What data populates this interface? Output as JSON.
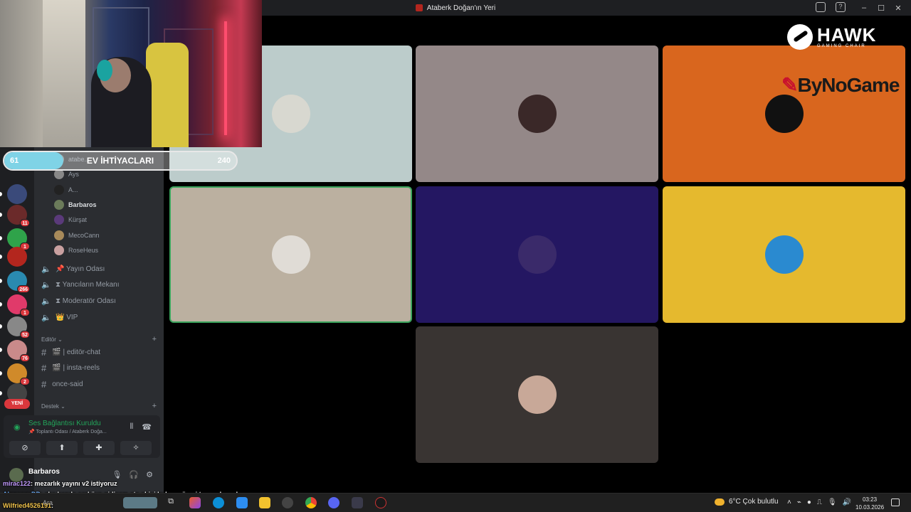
{
  "window": {
    "title": "Ataberk Doğan'ın Yeri",
    "controls": [
      "–",
      "☐",
      "✕"
    ]
  },
  "goal": {
    "current": "61",
    "label": "EV İHTİYACLARI",
    "target": "240",
    "progress_fraction": 0.254
  },
  "servers": [
    {
      "name": "server-1",
      "badge": "",
      "color": "#3a4a7a"
    },
    {
      "name": "server-2",
      "badge": "11",
      "color": "#6b2a2a"
    },
    {
      "name": "server-3",
      "badge": "1",
      "color": "#2fa34a"
    },
    {
      "name": "server-4",
      "badge": "",
      "color": "#b3261e"
    },
    {
      "name": "server-5",
      "badge": "266",
      "color": "#2a8ab0"
    },
    {
      "name": "server-6",
      "badge": "1",
      "color": "#e03a6a"
    },
    {
      "name": "server-7",
      "badge": "52",
      "color": "#888888"
    },
    {
      "name": "server-8",
      "badge": "76",
      "color": "#c98a8a"
    },
    {
      "name": "server-9",
      "badge": "2",
      "color": "#d08a2a"
    },
    {
      "name": "server-10",
      "badge": "",
      "color": "#444444"
    }
  ],
  "new_label": "YENİ",
  "voice_users": [
    {
      "name": "atabe...",
      "bold": false
    },
    {
      "name": "Ays",
      "bold": false
    },
    {
      "name": "A...",
      "bold": false
    },
    {
      "name": "Barbaros",
      "bold": true
    },
    {
      "name": "Kürşat",
      "bold": false
    },
    {
      "name": "MecoCann",
      "bold": false
    },
    {
      "name": "RoseHeus",
      "bold": false
    }
  ],
  "voice_channels": [
    {
      "icon": "📌",
      "label": "Yayın Odası"
    },
    {
      "icon": "⧗",
      "label": "Yancıların Mekanı"
    },
    {
      "icon": "⧗",
      "label": "Moderatör Odası"
    },
    {
      "icon": "👑",
      "label": "VIP"
    }
  ],
  "categories": {
    "editor": "Editör",
    "support": "Destek"
  },
  "text_channels": [
    {
      "label": "🎬 | editör-chat"
    },
    {
      "label": "🎬 | insta-reels"
    },
    {
      "label": "once-said"
    }
  ],
  "voice_panel": {
    "status": "Ses Bağlantısı Kuruldu",
    "location": "📌 Toplantı Odası / Ataberk Doğa...",
    "buttons": [
      "⊘",
      "⬆",
      "✚",
      "✧"
    ]
  },
  "user_panel": {
    "name": "Barbaros"
  },
  "tiles": [
    {
      "bg": "#bccccb",
      "avatar": "#d8d8d0",
      "active": false
    },
    {
      "bg": "#948888",
      "avatar": "#3a2828",
      "active": false
    },
    {
      "bg": "#d9661e",
      "avatar": "#111111",
      "active": false
    },
    {
      "bg": "#bbb0a0",
      "avatar": "#e0dcd6",
      "active": true
    },
    {
      "bg": "#241762",
      "avatar": "#3a2a6a",
      "active": false
    },
    {
      "bg": "#e5b92e",
      "avatar": "#2a8ad0",
      "active": false
    },
    {
      "bg": "#393432",
      "avatar": "#c8a898",
      "active": false
    }
  ],
  "sponsors": {
    "hawk_big": "HAWK",
    "hawk_small": "GAMING CHAIR",
    "bynogame": "ByNoGame"
  },
  "chat": [
    {
      "user": "mirac122",
      "msg": ": mezarlık yayını v2 istiyoruz"
    },
    {
      "user": "AloneeexDD",
      "msg": ": aha bende şarköye gidicem ata abiyi bulma görevi tamamlancak"
    },
    {
      "user": "Wilfried4526191",
      "msg": ":"
    }
  ],
  "taskbar": {
    "search_placeholder": "Ara",
    "weather": "6°C  Çok bulutlu",
    "time": "03:23",
    "date": "10.03.2026"
  }
}
